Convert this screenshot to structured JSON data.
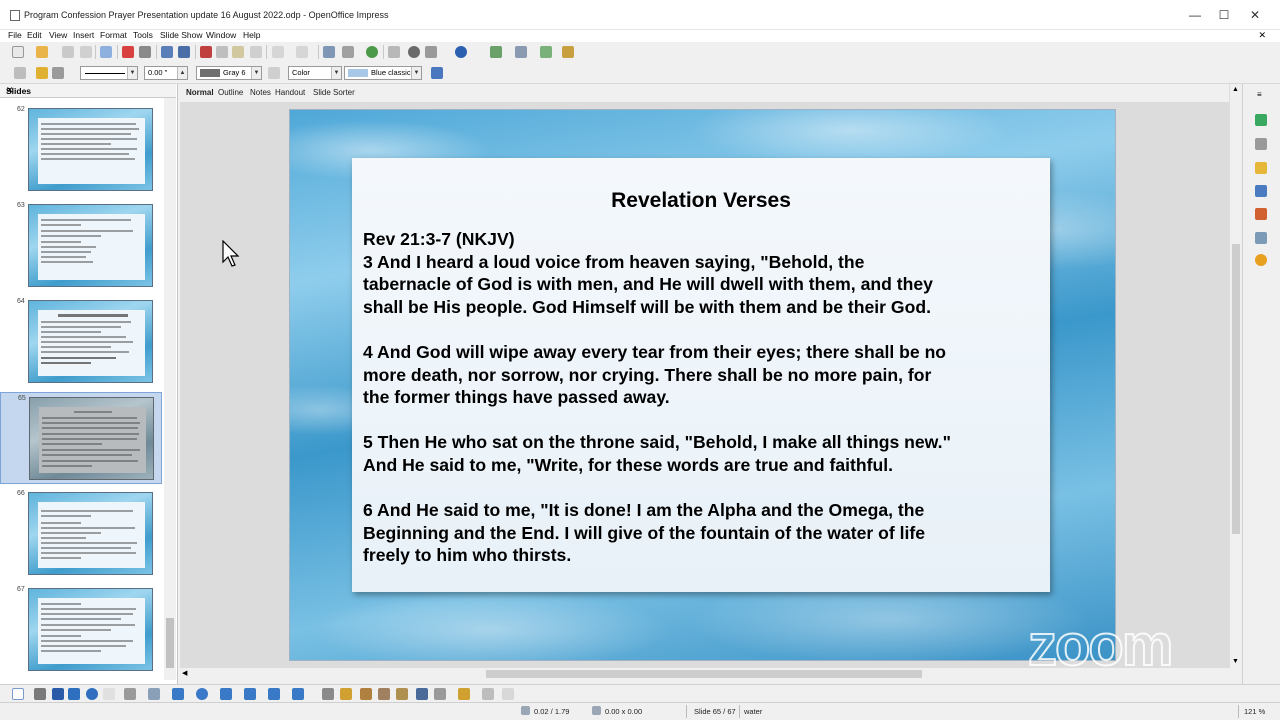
{
  "window": {
    "title": "Program Confession Prayer Presentation update  16 August 2022.odp - OpenOffice Impress",
    "minimize": "—",
    "maximize": "☐",
    "close": "✕",
    "doc_close": "✕"
  },
  "menu": [
    "File",
    "Edit",
    "View",
    "Insert",
    "Format",
    "Tools",
    "Slide Show",
    "Window",
    "Help"
  ],
  "toolbar2": {
    "line_width": "0.00 \"",
    "area_color": "Gray 6",
    "area_style": "Color",
    "fill_name": "Blue classic"
  },
  "slides_panel": {
    "title": "Slides",
    "close": "✕",
    "thumbnails": [
      {
        "number": "62",
        "selected": false
      },
      {
        "number": "63",
        "selected": false
      },
      {
        "number": "64",
        "selected": false
      },
      {
        "number": "65",
        "selected": true
      },
      {
        "number": "66",
        "selected": false
      },
      {
        "number": "67",
        "selected": false
      }
    ]
  },
  "view_tabs": [
    "Normal",
    "Outline",
    "Notes",
    "Handout",
    "Slide Sorter"
  ],
  "active_view": "Normal",
  "slide": {
    "title": "Revelation Verses",
    "lines": [
      "Rev 21:3-7 (NKJV)",
      " 3  And I heard a loud voice from heaven saying, \"Behold, the",
      "tabernacle of God is with men, and He will dwell with them, and they",
      "shall be His people. God Himself will be with them and be their God.",
      "",
      "4 And God will wipe away every tear from their eyes; there shall be no",
      "more death, nor sorrow, nor crying. There shall be no more pain, for",
      "the former things have passed away.",
      "",
      "5 Then He who sat on the throne said, \"Behold, I make all things new.\"",
      "And He said to me, \"Write, for these words are true and faithful.",
      "",
      "6 And He said to me, \"It is done! I am the Alpha and the Omega, the",
      "Beginning and the End. I will give of the fountain of the water of life",
      "freely to him who thirsts."
    ]
  },
  "overlay_logo": "zoom",
  "status": {
    "position": "0.02 / 1.79",
    "size": "0.00 x 0.00",
    "slide": "Slide 65 / 67",
    "master": "water",
    "zoom": "121 %"
  },
  "colors": {
    "selected_thumb": "#c5d7ee",
    "water_blue": "#4fa8d8",
    "card": "#f4f8fc"
  }
}
